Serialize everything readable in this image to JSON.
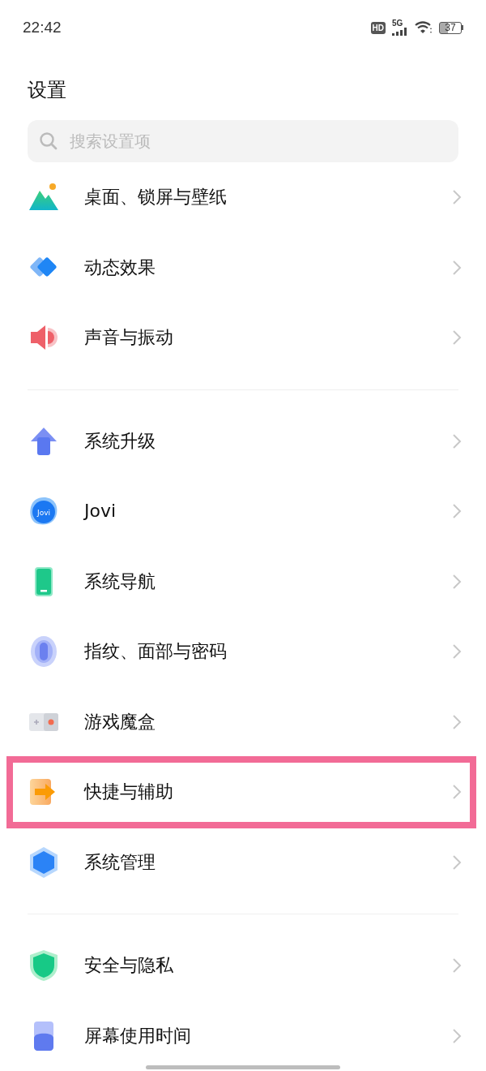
{
  "status_bar": {
    "time": "22:42",
    "hd_badge": "HD",
    "network": "5G",
    "battery": "37"
  },
  "title": "设置",
  "search": {
    "placeholder": "搜索设置项"
  },
  "groups": [
    [
      {
        "label": "桌面、锁屏与壁纸",
        "highlighted": false
      },
      {
        "label": "动态效果",
        "highlighted": false
      },
      {
        "label": "声音与振动",
        "highlighted": false
      }
    ],
    [
      {
        "label": "系统升级",
        "highlighted": false
      },
      {
        "label": "Jovi",
        "icon_text": "Jovi",
        "highlighted": false
      },
      {
        "label": "系统导航",
        "highlighted": false
      },
      {
        "label": "指纹、面部与密码",
        "highlighted": false
      },
      {
        "label": "游戏魔盒",
        "highlighted": false
      },
      {
        "label": "快捷与辅助",
        "highlighted": true
      },
      {
        "label": "系统管理",
        "highlighted": false
      }
    ],
    [
      {
        "label": "安全与隐私",
        "highlighted": false
      },
      {
        "label": "屏幕使用时间",
        "highlighted": false
      }
    ]
  ]
}
